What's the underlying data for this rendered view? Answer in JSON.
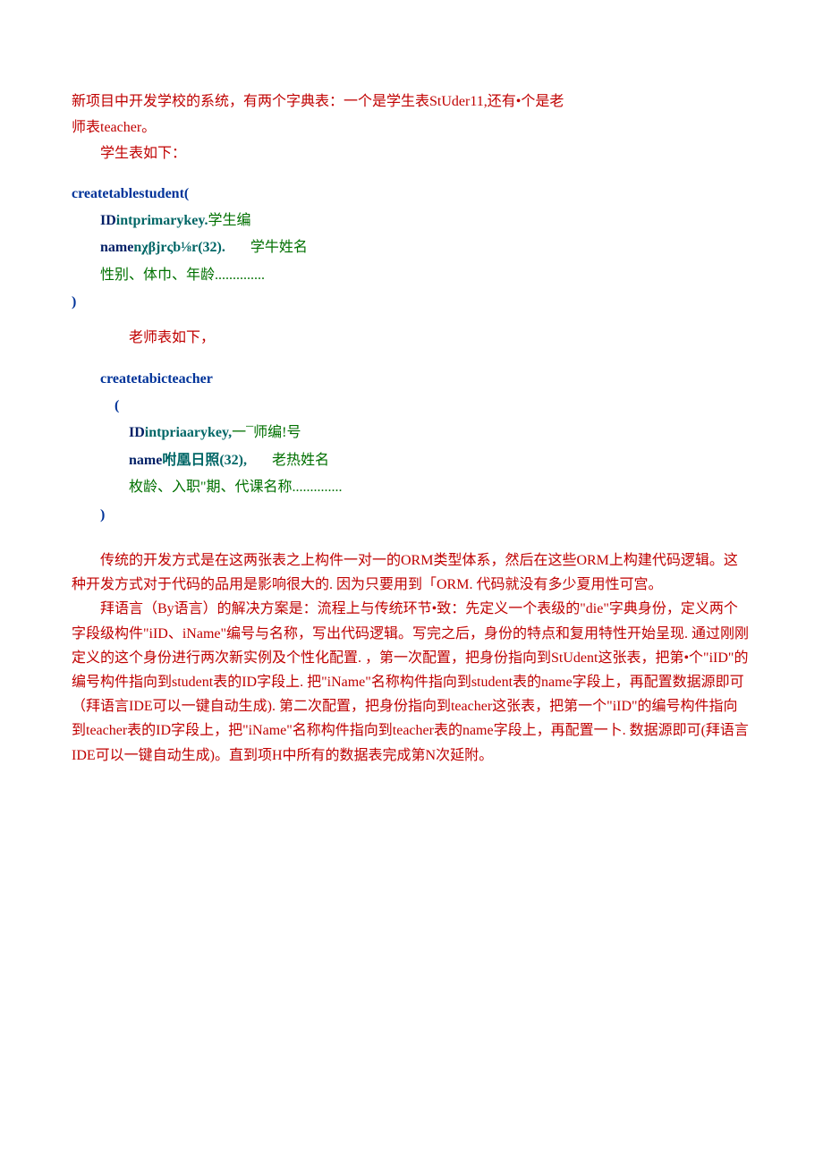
{
  "intro": {
    "line1_a": "新项目中开发学校的系统，有两个字典表：一个是学生表StUder11,还有•个是老",
    "line1_b": "师表teacher。",
    "line2": "学生表如下：",
    "line3": "老师表如下，"
  },
  "sql1": {
    "create_kw": "createtable",
    "table": "student(",
    "id_field": "ID",
    "id_type": "intprimarykey.",
    "id_comment": "学生编",
    "name_field": "name",
    "name_type": "nχβjrςb⅛r(32).",
    "name_comment": "学牛姓名",
    "etc": "性别、体巾、年龄..............",
    "close": ")"
  },
  "sql2": {
    "create_kw": "createtabic",
    "table": "teacher",
    "open": "(",
    "id_field": "ID",
    "id_type": "intpriaarykey,",
    "id_comment": "一¯师编!号",
    "name_field": "name",
    "name_type": "咐凰日照(32),",
    "name_comment": "老热姓名",
    "etc": "枚龄、入职\"期、代课名称..............",
    "close": ")"
  },
  "para1": "传统的开发方式是在这两张表之上构件一对一的ORM类型体系，然后在这些ORM上构建代码逻辑。这种开发方式对于代码的品用是影响很大的. 因为只要用到「ORM. 代码就没有多少夏用性可宫。",
  "para2": "拜语言（By语言）的解决方案是：流程上与传统环节•致：先定义一个表级的\"die\"字典身份，定义两个字段级构件\"iID、iName\"编号与名称，写出代码逻辑。写完之后，身份的特点和复用特性开始呈现. 通过刚刚定义的这个身份进行两次新实例及个性化配置. ，第一次配置，把身份指向到StUdent这张表，把第•个\"iID\"的编号构件指向到student表的ID字段上. 把\"iName\"名称构件指向到student表的name字段上，再配置数据源即可（拜语言IDE可以一键自动生成). 第二次配置，把身份指向到teacher这张表，把第一个\"iID\"的编号构件指向到teacher表的ID字段上，把\"iName\"名称构件指向到teacher表的name字段上，再配置一卜. 数据源即可(拜语言IDE可以一键自动生成)。直到项H中所有的数据表完成第N次延附。"
}
